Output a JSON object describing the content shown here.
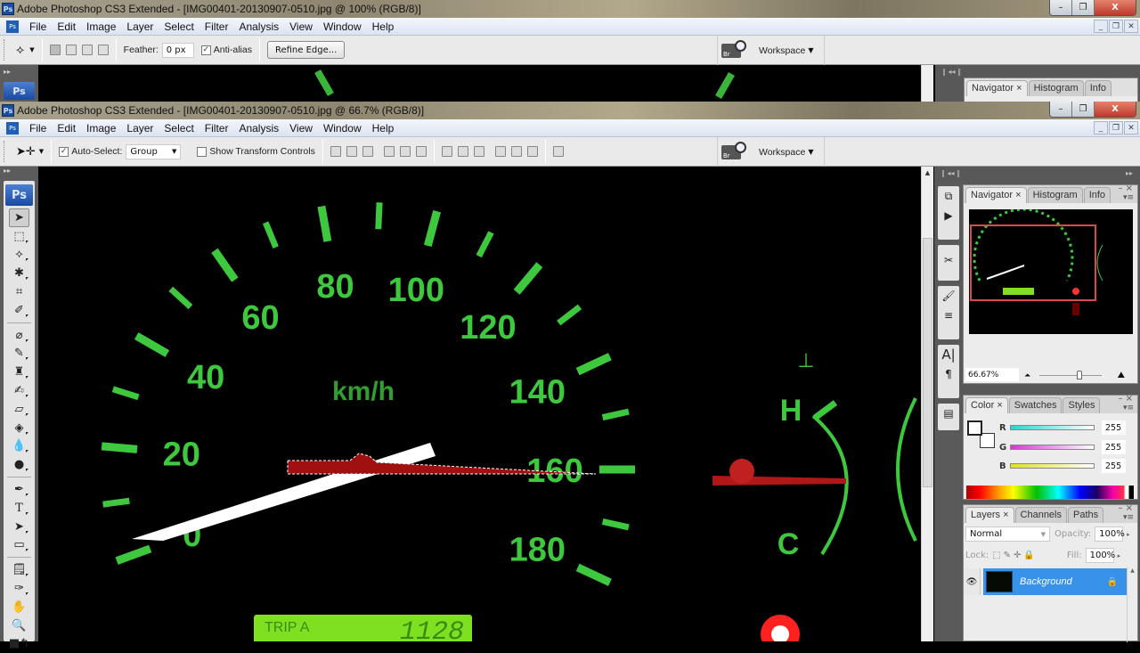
{
  "back_window": {
    "title": "Adobe Photoshop CS3 Extended - [IMG00401-20130907-0510.jpg @ 100% (RGB/8)]",
    "menu": [
      "File",
      "Edit",
      "Image",
      "Layer",
      "Select",
      "Filter",
      "Analysis",
      "View",
      "Window",
      "Help"
    ],
    "options": {
      "tool": "polygonal-lasso",
      "feather_label": "Feather:",
      "feather_value": "0 px",
      "antialias_label": "Anti-alias",
      "antialias_checked": true,
      "refine_edge_label": "Refine Edge..."
    },
    "workspace_label": "Workspace",
    "panel_tabs": [
      "Navigator",
      "Histogram",
      "Info"
    ]
  },
  "front_window": {
    "title": "Adobe Photoshop CS3 Extended - [IMG00401-20130907-0510.jpg @ 66.7% (RGB/8)]",
    "menu": [
      "File",
      "Edit",
      "Image",
      "Layer",
      "Select",
      "Filter",
      "Analysis",
      "View",
      "Window",
      "Help"
    ],
    "options": {
      "tool": "move",
      "auto_select_label": "Auto-Select:",
      "auto_select_checked": true,
      "auto_select_value": "Group",
      "show_transform_label": "Show Transform Controls",
      "show_transform_checked": false
    },
    "workspace_label": "Workspace",
    "window_controls": {
      "minimize": "–",
      "restore": "❐",
      "close": "X"
    }
  },
  "toolbox": {
    "logo": "Ps",
    "tools": [
      "move",
      "marquee",
      "lasso",
      "magic-wand",
      "crop",
      "slice",
      "spot-healing",
      "brush",
      "clone-stamp",
      "history-brush",
      "eraser",
      "paint-bucket",
      "blur",
      "dodge",
      "pen",
      "type",
      "path-selection",
      "rectangle",
      "notes",
      "eyedropper",
      "hand",
      "zoom"
    ]
  },
  "canvas": {
    "speed_labels": [
      "0",
      "20",
      "40",
      "60",
      "80",
      "100",
      "120",
      "140",
      "160",
      "180"
    ],
    "unit": "km/h",
    "temp_labels": {
      "hot": "H",
      "cold": "C"
    },
    "trip_label": "TRIP A",
    "trip_value": "1128"
  },
  "navigator": {
    "tabs": [
      "Navigator",
      "Histogram",
      "Info"
    ],
    "zoom": "66.67%",
    "zoom_slider_fraction": 0.6
  },
  "color": {
    "tabs": [
      "Color",
      "Swatches",
      "Styles"
    ],
    "channels": [
      {
        "label": "R",
        "value": "255",
        "color": "#27d5d5"
      },
      {
        "label": "G",
        "value": "255",
        "color": "#d537d5"
      },
      {
        "label": "B",
        "value": "255",
        "color": "#e0e020"
      }
    ]
  },
  "layers": {
    "tabs": [
      "Layers",
      "Channels",
      "Paths"
    ],
    "blend_mode": "Normal",
    "opacity_label": "Opacity:",
    "opacity": "100%",
    "lock_label": "Lock:",
    "fill_label": "Fill:",
    "fill": "100%",
    "items": [
      {
        "name": "Background",
        "visible": true,
        "locked": true,
        "selected": true
      }
    ]
  },
  "colors": {
    "gauge_green": "#3ec83e",
    "needle_red": "#a01010",
    "selection_blue": "#3892ea"
  }
}
